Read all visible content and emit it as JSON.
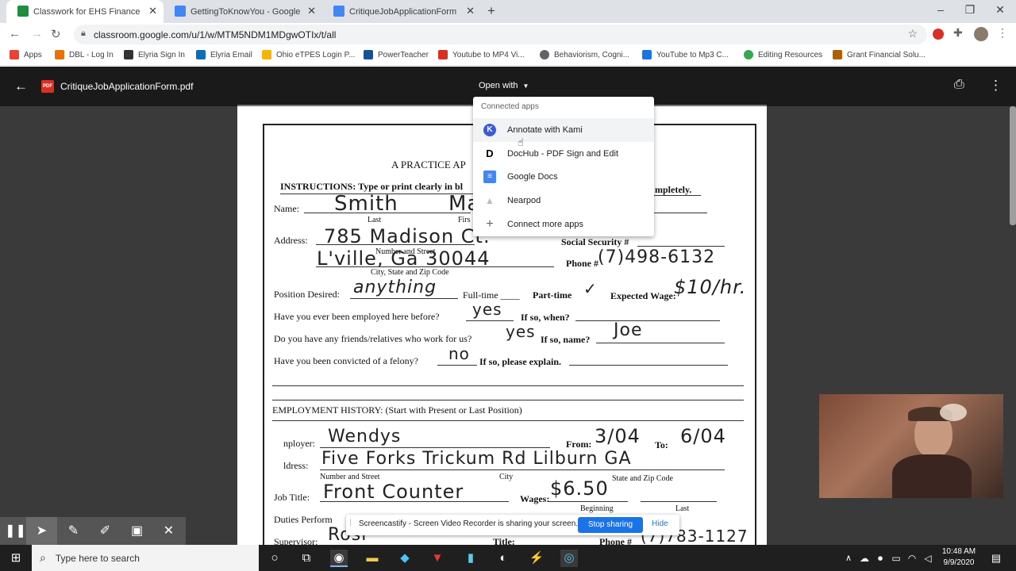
{
  "browser": {
    "tabs": [
      {
        "title": "Classwork for EHS Finance Virtua",
        "color": "#1e8e3e",
        "active": true
      },
      {
        "title": "GettingToKnowYou - Google Do",
        "color": "#4285f4",
        "active": false
      },
      {
        "title": "CritiqueJobApplicationForm - Go",
        "color": "#4285f4",
        "active": false
      }
    ],
    "new_tab": "+",
    "window": {
      "minimize": "–",
      "maximize": "❐",
      "close": "✕"
    },
    "url": "classroom.google.com/u/1/w/MTM5NDM1MDgwOTIx/t/all",
    "bookmarks": [
      {
        "label": "Apps",
        "color": "#ea4335"
      },
      {
        "label": "DBL - Log In",
        "color": "#e8710a"
      },
      {
        "label": "Elyria Sign In",
        "color": "#333333"
      },
      {
        "label": "Elyria Email",
        "color": "#0f6cbd"
      },
      {
        "label": "Ohio eTPES Login P...",
        "color": "#f4b400"
      },
      {
        "label": "PowerTeacher",
        "color": "#1a4f9c"
      },
      {
        "label": "Youtube to MP4 Vi...",
        "color": "#d93025"
      },
      {
        "label": "Behaviorism, Cogni...",
        "color": "#5f6368"
      },
      {
        "label": "YouTube to Mp3 C...",
        "color": "#1a73e8"
      },
      {
        "label": "Editing Resources",
        "color": "#34a853"
      },
      {
        "label": "Grant Financial Solu...",
        "color": "#b06000"
      }
    ]
  },
  "viewer": {
    "file_name": "CritiqueJobApplicationForm.pdf",
    "open_with": "Open with",
    "menu": {
      "header": "Connected apps",
      "items": [
        {
          "label": "Annotate with Kami",
          "icon": "kami-icon",
          "glyph": "K"
        },
        {
          "label": "DocHub - PDF Sign and Edit",
          "icon": "dochub-icon",
          "glyph": "D"
        },
        {
          "label": "Google Docs",
          "icon": "docs-icon",
          "glyph": "≡"
        },
        {
          "label": "Nearpod",
          "icon": "nearpod-icon",
          "glyph": "▲"
        },
        {
          "label": "Connect more apps",
          "icon": "plus-icon",
          "glyph": "+"
        }
      ]
    }
  },
  "form": {
    "title": "A PRACTICE AP",
    "instructions": "INSTRUCTIONS:  Type or print clearly in bl",
    "instructions_end": "mpletely.",
    "name_label": "Name:",
    "name_value": "Smith",
    "name_value2": "Ma",
    "last_label": "Last",
    "first_label": "Firs",
    "address_label": "Address:",
    "address_value": "785 Madison Ct.",
    "number_street": "Number and Street",
    "social_security": "Social Security #",
    "city_value": "L'ville, Ga 30044",
    "city_label": "City, State and Zip Code",
    "phone_label": "Phone #",
    "phone_value": "(7)498-6132",
    "position_label": "Position Desired:",
    "position_value": "anything",
    "fulltime": "Full-time ____",
    "parttime": "Part-time",
    "parttime_mark": "✓",
    "wage_label": "Expected Wage:",
    "wage_value": "$10/hr.",
    "employed_label": "Have you ever been employed here before?",
    "employed_value": "yes",
    "ifso_when": "If so, when?",
    "friends_label": "Do you have any friends/relatives who work for us?",
    "friends_value": "yes",
    "ifso_name": "If so, name?",
    "friends_name": "Joe",
    "felony_label": "Have you been convicted of a felony?",
    "felony_value": "no",
    "explain_label": "If so, please explain.",
    "employment_history": "EMPLOYMENT HISTORY:  (Start with Present or Last Position)",
    "employer_label": "nployer:",
    "employer_value": "Wendys",
    "from_label": "From:",
    "from_value": "3/04",
    "to_label": "To:",
    "to_value": "6/04",
    "address2_label": "ldress:",
    "address2_value": "Five Forks Trickum Rd  Lilburn    GA",
    "number_street2": "Number and Street",
    "city2": "City",
    "state_zip2": "State and Zip Code",
    "job_label": "Job Title:",
    "job_value": "Front Counter",
    "wages_label": "Wages:",
    "wages_value": "$6.50",
    "beginning": "Beginning",
    "last2": "Last",
    "duties_label": "Duties Perform",
    "supervisor_label": "Supervisor:",
    "supervisor_value": "Rosi",
    "title2": "Title:",
    "phone2": "Phone #",
    "phone2_value": "(7)783-1127"
  },
  "screencast": {
    "message": "Screencastify - Screen Video Recorder is sharing your screen.",
    "stop": "Stop sharing",
    "hide": "Hide"
  },
  "taskbar": {
    "search": "Type here to search",
    "time": "10:48 AM",
    "date": "9/9/2020"
  }
}
